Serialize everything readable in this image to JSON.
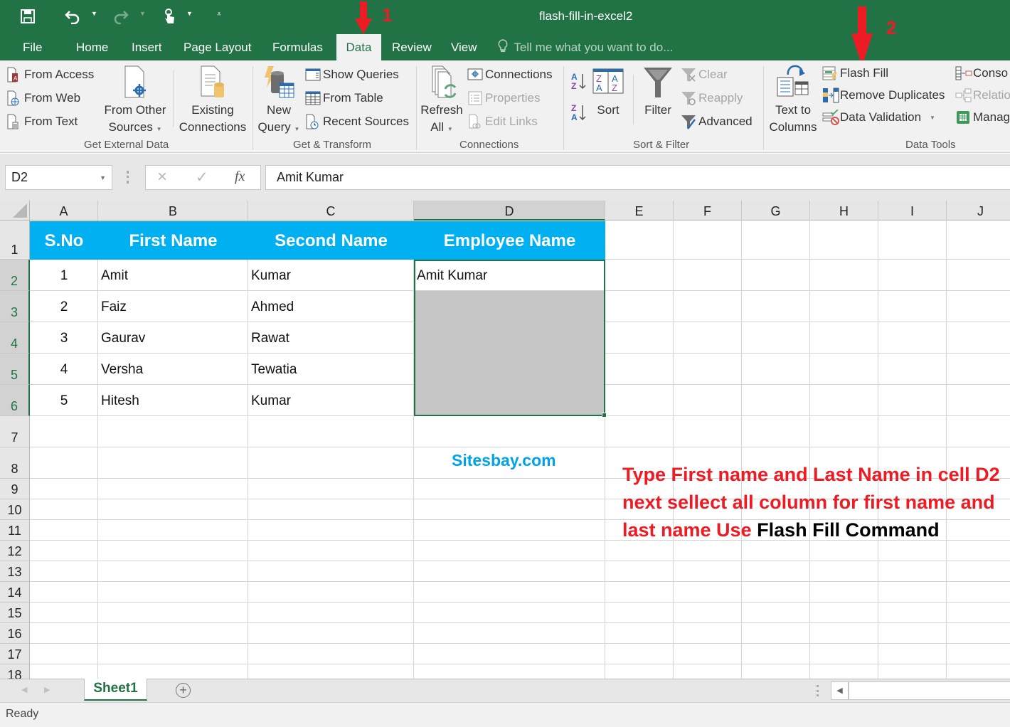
{
  "window": {
    "title": "flash-fill-in-excel2"
  },
  "quick_access": {
    "save_icon": "save-icon",
    "undo_icon": "undo-icon",
    "redo_icon": "redo-icon",
    "touch_mode_icon": "touch-mode-icon",
    "customize_icon": "customize-qat-icon"
  },
  "tabs": [
    {
      "label": "File"
    },
    {
      "label": "Home"
    },
    {
      "label": "Insert"
    },
    {
      "label": "Page Layout"
    },
    {
      "label": "Formulas"
    },
    {
      "label": "Data",
      "active": true
    },
    {
      "label": "Review"
    },
    {
      "label": "View"
    }
  ],
  "tell_me": {
    "placeholder": "Tell me what you want to do..."
  },
  "ribbon": {
    "get_external_data": {
      "label": "Get External Data",
      "from_access": "From Access",
      "from_web": "From Web",
      "from_text": "From Text",
      "from_other_sources_1": "From Other",
      "from_other_sources_2": "Sources",
      "existing_connections_1": "Existing",
      "existing_connections_2": "Connections"
    },
    "get_transform": {
      "label": "Get & Transform",
      "new_query_1": "New",
      "new_query_2": "Query",
      "show_queries": "Show Queries",
      "from_table": "From Table",
      "recent_sources": "Recent Sources"
    },
    "connections": {
      "label": "Connections",
      "refresh_all_1": "Refresh",
      "refresh_all_2": "All",
      "connections": "Connections",
      "properties": "Properties",
      "edit_links": "Edit Links"
    },
    "sort_filter": {
      "label": "Sort & Filter",
      "sort": "Sort",
      "filter": "Filter",
      "clear": "Clear",
      "reapply": "Reapply",
      "advanced": "Advanced"
    },
    "data_tools": {
      "label": "Data Tools",
      "text_to_columns_1": "Text to",
      "text_to_columns_2": "Columns",
      "flash_fill": "Flash Fill",
      "remove_duplicates": "Remove Duplicates",
      "data_validation": "Data Validation",
      "consolidate": "Conso",
      "relationships": "Relatio",
      "manage_data_model": "Manag"
    }
  },
  "formula_bar": {
    "name_box": "D2",
    "cancel_icon": "×",
    "enter_icon": "✓",
    "fx": "fx",
    "value": "Amit Kumar"
  },
  "sheet": {
    "columns": [
      "A",
      "B",
      "C",
      "D",
      "E",
      "F",
      "G",
      "H",
      "I",
      "J"
    ],
    "rows": [
      "1",
      "2",
      "3",
      "4",
      "5",
      "6",
      "7",
      "8",
      "9",
      "10",
      "11",
      "12",
      "13",
      "14",
      "15",
      "16",
      "17",
      "18"
    ],
    "header_row": [
      "S.No",
      "First Name",
      "Second Name",
      "Employee Name"
    ],
    "data_rows": [
      {
        "sno": "1",
        "first": "Amit",
        "second": "Kumar",
        "employee": "Amit Kumar"
      },
      {
        "sno": "2",
        "first": "Faiz",
        "second": "Ahmed",
        "employee": ""
      },
      {
        "sno": "3",
        "first": "Gaurav",
        "second": "Rawat",
        "employee": ""
      },
      {
        "sno": "4",
        "first": "Versha",
        "second": "Tewatia",
        "employee": ""
      },
      {
        "sno": "5",
        "first": "Hitesh",
        "second": "Kumar",
        "employee": ""
      }
    ],
    "selected_cell": "D2",
    "selected_range": "D2:D6",
    "header_fill_color": "#00b0f0"
  },
  "annotations": {
    "marker_1": "1",
    "marker_2": "2",
    "watermark": "Sitesbay.com",
    "note_line1": "Type First name and Last Name in cell D2",
    "note_line2": "next sellect all column for first name and",
    "note_line3_red": "last name Use ",
    "note_line3_black": "Flash Fill Command"
  },
  "sheet_tabs": {
    "tabs": [
      "Sheet1"
    ],
    "active": "Sheet1",
    "add_icon": "+"
  },
  "status": {
    "text": "Ready"
  },
  "colors": {
    "excel_green": "#217346",
    "annotation_red": "#ed1c24",
    "watermark_blue": "#00a2e8"
  }
}
